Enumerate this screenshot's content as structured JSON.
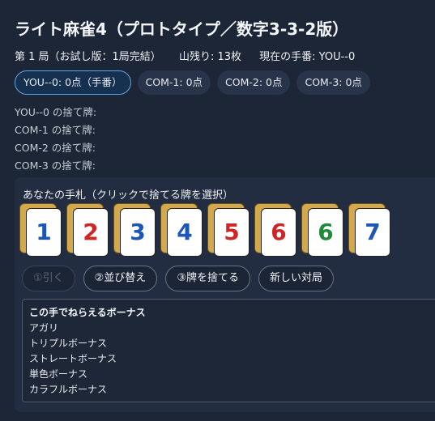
{
  "title": "ライト麻雀4（プロトタイプ／数字3-3-2版）",
  "status": {
    "round": "第 1 局（お試し版：1局完結）",
    "remaining": "山残り: 13枚",
    "turn": "現在の手番: YOU--0"
  },
  "players": [
    {
      "label": "YOU--0: 0点（手番）",
      "active": true
    },
    {
      "label": "COM-1: 0点",
      "active": false
    },
    {
      "label": "COM-2: 0点",
      "active": false
    },
    {
      "label": "COM-3: 0点",
      "active": false
    }
  ],
  "discards": [
    "YOU--0 の捨て牌:",
    "COM-1 の捨て牌:",
    "COM-2 の捨て牌:",
    "COM-3 の捨て牌:"
  ],
  "hand": {
    "label": "あなたの手札（クリックで捨てる牌を選択）",
    "tiles": [
      {
        "value": "1",
        "color": "#1e56b8"
      },
      {
        "value": "2",
        "color": "#cf2525"
      },
      {
        "value": "3",
        "color": "#1e56b8"
      },
      {
        "value": "4",
        "color": "#1e56b8"
      },
      {
        "value": "5",
        "color": "#cf2525"
      },
      {
        "value": "6",
        "color": "#cf2525"
      },
      {
        "value": "6",
        "color": "#1f8a3a"
      },
      {
        "value": "7",
        "color": "#1e56b8"
      }
    ]
  },
  "actions": {
    "draw": "①引く",
    "sort": "②並び替え",
    "discard": "③牌を捨てる",
    "new_game": "新しい対局"
  },
  "bonus": {
    "title": "この手でねらえるボーナス",
    "items": [
      "アガリ",
      "トリプルボーナス",
      "ストレートボーナス",
      "単色ボーナス",
      "カラフルボーナス"
    ]
  }
}
